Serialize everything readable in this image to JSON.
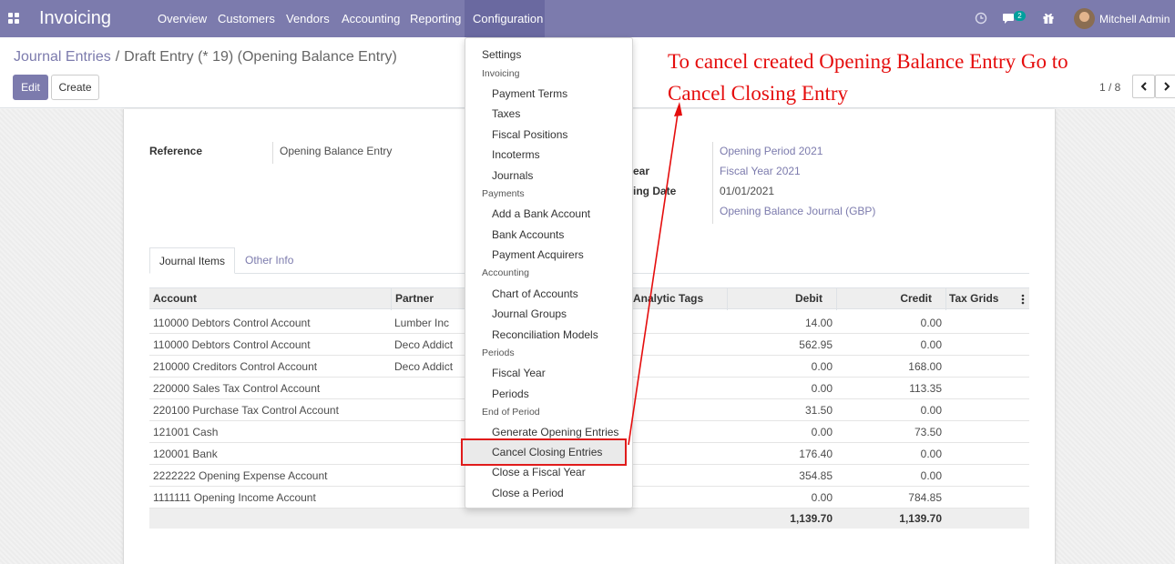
{
  "navbar": {
    "brand": "Invoicing",
    "menus": [
      "Overview",
      "Customers",
      "Vendors",
      "Accounting",
      "Reporting",
      "Configuration"
    ],
    "active_menu": "Configuration",
    "chat_badge": "2",
    "user_name": "Mitchell Admin",
    "icons": [
      "apps-icon",
      "clock-icon",
      "chat-icon",
      "gift-icon"
    ]
  },
  "control_panel": {
    "breadcrumb_parent": "Journal Entries",
    "breadcrumb_sep": "/",
    "breadcrumb_current": "Draft Entry (* 19) (Opening Balance Entry)",
    "edit_label": "Edit",
    "create_label": "Create",
    "pager": "1 / 8"
  },
  "form": {
    "reference_label": "Reference",
    "reference_value": "Opening Balance Entry",
    "right_labels": [
      "ear",
      "ing Date"
    ],
    "right_values": [
      "Opening Period 2021",
      "Fiscal Year 2021",
      "01/01/2021",
      "Opening Balance Journal (GBP)"
    ]
  },
  "tabs": [
    "Journal Items",
    "Other Info"
  ],
  "table": {
    "headers": [
      "Account",
      "Partner",
      "Analytic Tags",
      "Debit",
      "Credit",
      "Tax Grids"
    ],
    "rows": [
      {
        "account": "110000 Debtors Control Account",
        "partner": "Lumber Inc",
        "debit": "14.00",
        "credit": "0.00"
      },
      {
        "account": "110000 Debtors Control Account",
        "partner": "Deco Addict",
        "debit": "562.95",
        "credit": "0.00"
      },
      {
        "account": "210000 Creditors Control Account",
        "partner": "Deco Addict",
        "debit": "0.00",
        "credit": "168.00"
      },
      {
        "account": "220000 Sales Tax Control Account",
        "partner": "",
        "debit": "0.00",
        "credit": "113.35"
      },
      {
        "account": "220100 Purchase Tax Control Account",
        "partner": "",
        "debit": "31.50",
        "credit": "0.00"
      },
      {
        "account": "121001 Cash",
        "partner": "",
        "debit": "0.00",
        "credit": "73.50"
      },
      {
        "account": "120001 Bank",
        "partner": "",
        "debit": "176.40",
        "credit": "0.00"
      },
      {
        "account": "2222222 Opening Expense Account",
        "partner": "",
        "debit": "354.85",
        "credit": "0.00"
      },
      {
        "account": "1111111 Opening Income Account",
        "partner": "",
        "debit": "0.00",
        "credit": "784.85"
      }
    ],
    "total_debit": "1,139.70",
    "total_credit": "1,139.70"
  },
  "dropdown": {
    "settings": "Settings",
    "sections": [
      {
        "header": "Invoicing",
        "items": [
          "Payment Terms",
          "Taxes",
          "Fiscal Positions",
          "Incoterms",
          "Journals"
        ]
      },
      {
        "header": "Payments",
        "items": [
          "Add a Bank Account",
          "Bank Accounts",
          "Payment Acquirers"
        ]
      },
      {
        "header": "Accounting",
        "items": [
          "Chart of Accounts",
          "Journal Groups",
          "Reconciliation Models"
        ]
      },
      {
        "header": "Periods",
        "items": [
          "Fiscal Year",
          "Periods"
        ]
      },
      {
        "header": "End of Period",
        "items": [
          "Generate Opening Entries",
          "Cancel Closing Entries",
          "Close a Fiscal Year",
          "Close a Period"
        ]
      }
    ],
    "highlighted": "Cancel Closing Entries"
  },
  "annotation": {
    "line1": "To cancel created Opening Balance Entry Go to",
    "line2": "Cancel Closing Entry",
    "color": "#e50d0d"
  },
  "colors": {
    "navbar": "#7c7bad",
    "link": "#7c7bad",
    "highlight_border": "#e01b1b"
  }
}
